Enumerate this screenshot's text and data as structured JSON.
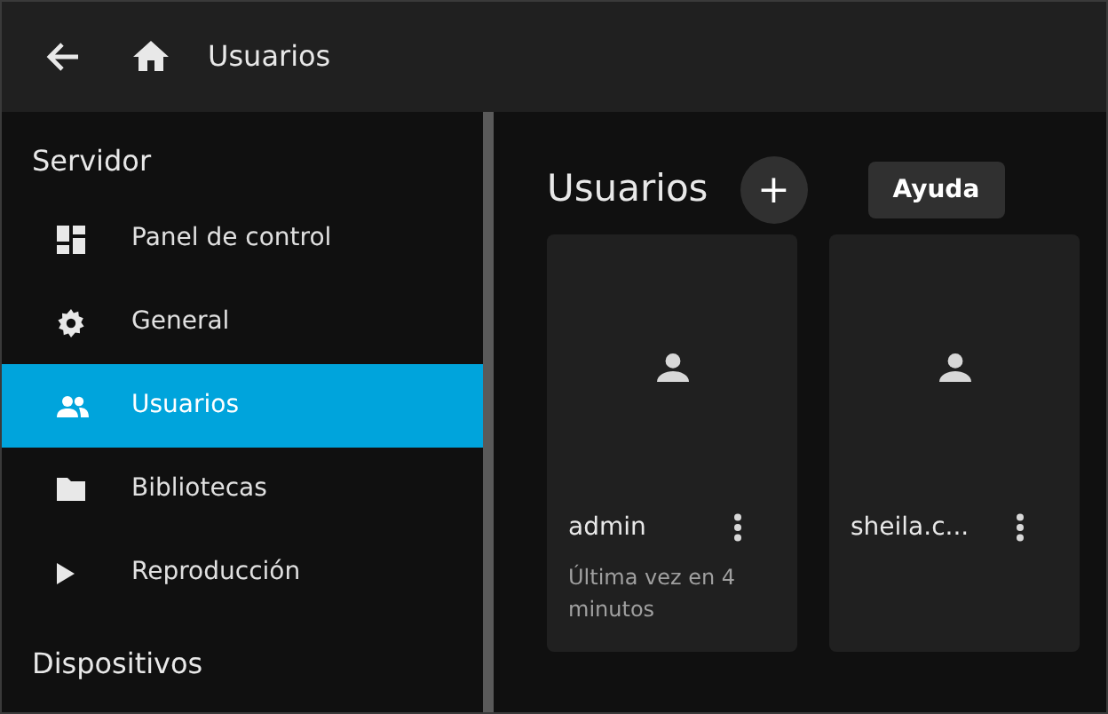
{
  "header": {
    "title": "Usuarios"
  },
  "sidebar": {
    "items": [
      {
        "kind": "heading",
        "label": "Servidor"
      },
      {
        "kind": "item",
        "label": "Panel de control",
        "selected": false
      },
      {
        "kind": "item",
        "label": "General",
        "selected": false
      },
      {
        "kind": "item",
        "label": "Usuarios",
        "selected": true
      },
      {
        "kind": "item",
        "label": "Bibliotecas",
        "selected": false
      },
      {
        "kind": "item",
        "label": "Reproducción",
        "selected": false
      },
      {
        "kind": "heading",
        "label": "Dispositivos"
      }
    ]
  },
  "main": {
    "title": "Usuarios",
    "add_button": "+",
    "help_button": "Ayuda",
    "users": [
      {
        "name": "admin",
        "last_seen": "Última vez en 4 minutos"
      },
      {
        "name": "sheila.c..."
      }
    ]
  }
}
